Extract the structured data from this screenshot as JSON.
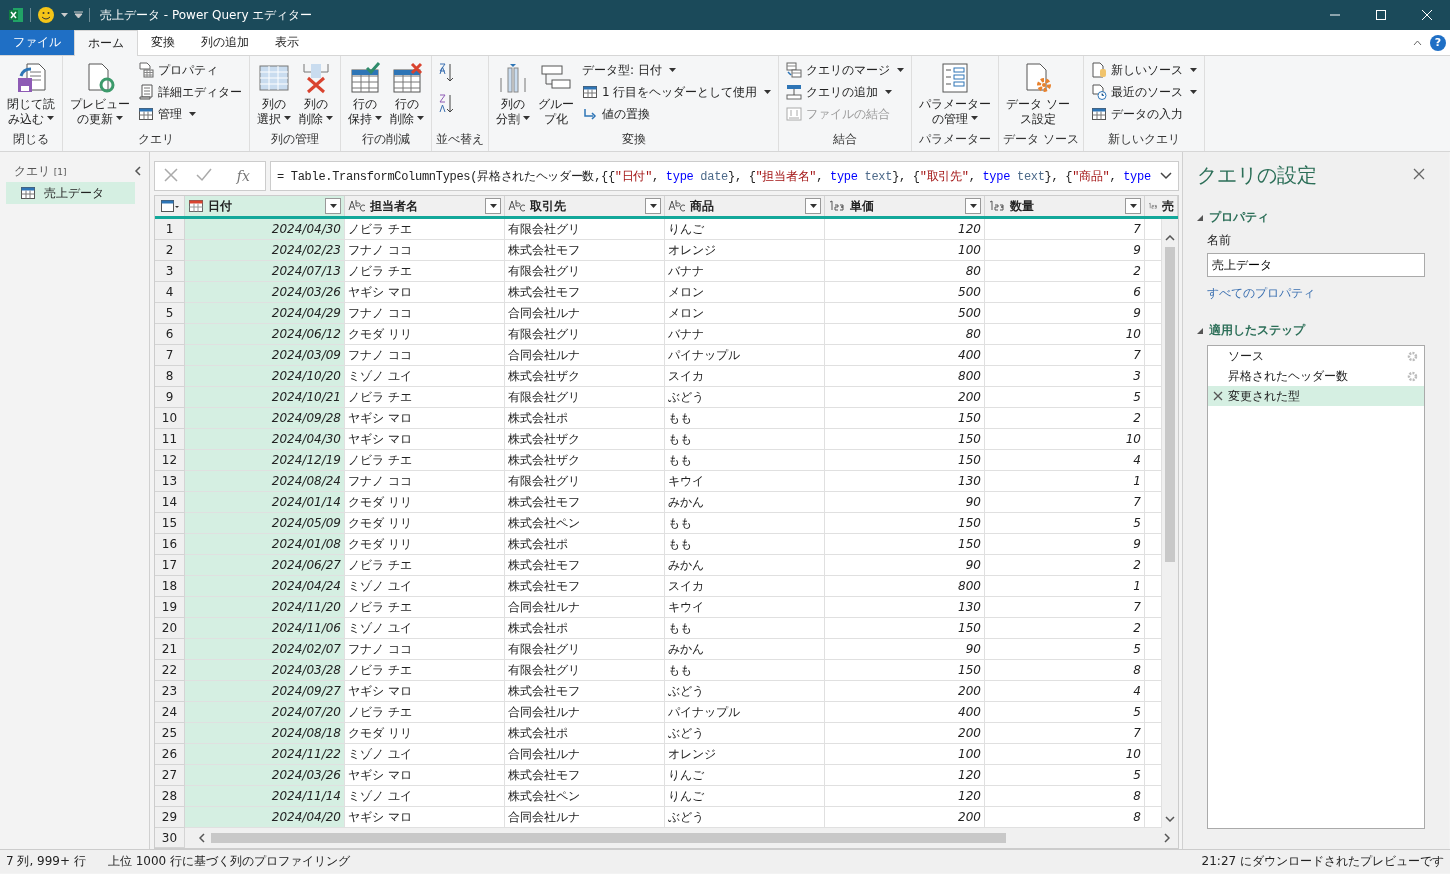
{
  "window": {
    "title": "売上データ - Power Query エディター"
  },
  "tabs": [
    {
      "label": "ファイル",
      "kind": "file",
      "selected": false
    },
    {
      "label": "ホーム",
      "kind": "tab",
      "selected": true
    },
    {
      "label": "変換",
      "kind": "tab",
      "selected": false
    },
    {
      "label": "列の追加",
      "kind": "tab",
      "selected": false
    },
    {
      "label": "表示",
      "kind": "tab",
      "selected": false
    }
  ],
  "help": "?",
  "ribbon": [
    {
      "label": "閉じる",
      "items": [
        {
          "kind": "big",
          "lines": [
            "閉じて読",
            "み込む"
          ],
          "dropdown": true
        }
      ]
    },
    {
      "label": "クエリ",
      "items": [
        {
          "kind": "big",
          "lines": [
            "プレビュー",
            "の更新"
          ],
          "dropdown": true
        },
        {
          "kind": "stack",
          "items": [
            {
              "label": "プロパティ",
              "dropdown": false,
              "disabled": false
            },
            {
              "label": "詳細エディター",
              "dropdown": false,
              "disabled": false
            },
            {
              "label": "管理",
              "dropdown": true,
              "disabled": false
            }
          ]
        }
      ]
    },
    {
      "label": "列の管理",
      "items": [
        {
          "kind": "big",
          "lines": [
            "列の",
            "選択"
          ],
          "dropdown": true
        },
        {
          "kind": "big",
          "lines": [
            "列の",
            "削除"
          ],
          "dropdown": true
        }
      ]
    },
    {
      "label": "行の削減",
      "items": [
        {
          "kind": "big",
          "lines": [
            "行の",
            "保持"
          ],
          "dropdown": true
        },
        {
          "kind": "big",
          "lines": [
            "行の",
            "削除"
          ],
          "dropdown": true
        }
      ]
    },
    {
      "label": "並べ替え",
      "items": [
        {
          "kind": "sort"
        }
      ]
    },
    {
      "label": "変換",
      "items": [
        {
          "kind": "big",
          "lines": [
            "列の",
            "分割"
          ],
          "dropdown": true
        },
        {
          "kind": "big",
          "lines": [
            "グルー",
            "プ化"
          ],
          "dropdown": false
        },
        {
          "kind": "stack",
          "items": [
            {
              "label": "データ型: 日付",
              "dropdown": true,
              "disabled": false
            },
            {
              "label": "1 行目をヘッダーとして使用",
              "dropdown": true,
              "disabled": false
            },
            {
              "label": "値の置換",
              "dropdown": false,
              "disabled": false
            }
          ]
        }
      ]
    },
    {
      "label": "結合",
      "items": [
        {
          "kind": "stack",
          "items": [
            {
              "label": "クエリのマージ",
              "dropdown": true,
              "disabled": false
            },
            {
              "label": "クエリの追加",
              "dropdown": true,
              "disabled": false
            },
            {
              "label": "ファイルの結合",
              "dropdown": false,
              "disabled": true
            }
          ]
        }
      ]
    },
    {
      "label": "パラメーター",
      "items": [
        {
          "kind": "big",
          "lines": [
            "パラメーター",
            "の管理"
          ],
          "dropdown": true
        }
      ]
    },
    {
      "label": "データ ソース",
      "items": [
        {
          "kind": "big",
          "lines": [
            "データ ソー",
            "ス設定"
          ],
          "dropdown": false
        }
      ]
    },
    {
      "label": "新しいクエリ",
      "items": [
        {
          "kind": "stack",
          "items": [
            {
              "label": "新しいソース",
              "dropdown": true,
              "disabled": false
            },
            {
              "label": "最近のソース",
              "dropdown": true,
              "disabled": false
            },
            {
              "label": "データの入力",
              "dropdown": false,
              "disabled": false
            }
          ]
        }
      ]
    }
  ],
  "queries": {
    "title": "クエリ",
    "count": "[1]",
    "items": [
      {
        "label": "売上データ",
        "selected": true
      }
    ]
  },
  "formula_bar": {
    "fx": "fx",
    "tokens": [
      {
        "kind": "plain",
        "text": "= Table.TransformColumnTypes(昇格されたヘッダー数,{{"
      },
      {
        "kind": "string",
        "text": "\"日付\""
      },
      {
        "kind": "plain",
        "text": ", "
      },
      {
        "kind": "keyword",
        "text": "type"
      },
      {
        "kind": "typename",
        "text": " date"
      },
      {
        "kind": "plain",
        "text": "}, {"
      },
      {
        "kind": "string",
        "text": "\"担当者名\""
      },
      {
        "kind": "plain",
        "text": ", "
      },
      {
        "kind": "keyword",
        "text": "type"
      },
      {
        "kind": "typename",
        "text": " text"
      },
      {
        "kind": "plain",
        "text": "}, {"
      },
      {
        "kind": "string",
        "text": "\"取引先\""
      },
      {
        "kind": "plain",
        "text": ", "
      },
      {
        "kind": "keyword",
        "text": "type"
      },
      {
        "kind": "typename",
        "text": " text"
      },
      {
        "kind": "plain",
        "text": "}, {"
      },
      {
        "kind": "string",
        "text": "\"商品\""
      },
      {
        "kind": "plain",
        "text": ", "
      },
      {
        "kind": "keyword",
        "text": "type"
      }
    ]
  },
  "table": {
    "columns": [
      {
        "name": "日付",
        "kind": "date",
        "selected": true
      },
      {
        "name": "担当者名",
        "kind": "text",
        "selected": false
      },
      {
        "name": "取引先",
        "kind": "text",
        "selected": false
      },
      {
        "name": "商品",
        "kind": "text",
        "selected": false
      },
      {
        "name": "単価",
        "kind": "number",
        "selected": false
      },
      {
        "name": "数量",
        "kind": "number",
        "selected": false
      },
      {
        "name": "売",
        "kind": "number",
        "selected": false
      }
    ],
    "rows": [
      {
        "num": "1",
        "cells": [
          "2024/04/30",
          "ノビラ チエ",
          "有限会社グリ",
          "りんご",
          "120",
          "7"
        ]
      },
      {
        "num": "2",
        "cells": [
          "2024/02/23",
          "フナノ ココ",
          "株式会社モフ",
          "オレンジ",
          "100",
          "9"
        ]
      },
      {
        "num": "3",
        "cells": [
          "2024/07/13",
          "ノビラ チエ",
          "有限会社グリ",
          "バナナ",
          "80",
          "2"
        ]
      },
      {
        "num": "4",
        "cells": [
          "2024/03/26",
          "ヤギシ マロ",
          "株式会社モフ",
          "メロン",
          "500",
          "6"
        ]
      },
      {
        "num": "5",
        "cells": [
          "2024/04/29",
          "フナノ ココ",
          "合同会社ルナ",
          "メロン",
          "500",
          "9"
        ]
      },
      {
        "num": "6",
        "cells": [
          "2024/06/12",
          "クモダ リリ",
          "有限会社グリ",
          "バナナ",
          "80",
          "10"
        ]
      },
      {
        "num": "7",
        "cells": [
          "2024/03/09",
          "フナノ ココ",
          "合同会社ルナ",
          "パイナップル",
          "400",
          "7"
        ]
      },
      {
        "num": "8",
        "cells": [
          "2024/10/20",
          "ミゾノ ユイ",
          "株式会社ザク",
          "スイカ",
          "800",
          "3"
        ]
      },
      {
        "num": "9",
        "cells": [
          "2024/10/21",
          "ノビラ チエ",
          "有限会社グリ",
          "ぶどう",
          "200",
          "5"
        ]
      },
      {
        "num": "10",
        "cells": [
          "2024/09/28",
          "ヤギシ マロ",
          "株式会社ポ",
          "もも",
          "150",
          "2"
        ]
      },
      {
        "num": "11",
        "cells": [
          "2024/04/30",
          "ヤギシ マロ",
          "株式会社ザク",
          "もも",
          "150",
          "10"
        ]
      },
      {
        "num": "12",
        "cells": [
          "2024/12/19",
          "ノビラ チエ",
          "株式会社ザク",
          "もも",
          "150",
          "4"
        ]
      },
      {
        "num": "13",
        "cells": [
          "2024/08/24",
          "フナノ ココ",
          "有限会社グリ",
          "キウイ",
          "130",
          "1"
        ]
      },
      {
        "num": "14",
        "cells": [
          "2024/01/14",
          "クモダ リリ",
          "株式会社モフ",
          "みかん",
          "90",
          "7"
        ]
      },
      {
        "num": "15",
        "cells": [
          "2024/05/09",
          "クモダ リリ",
          "株式会社ペン",
          "もも",
          "150",
          "5"
        ]
      },
      {
        "num": "16",
        "cells": [
          "2024/01/08",
          "クモダ リリ",
          "株式会社ポ",
          "もも",
          "150",
          "9"
        ]
      },
      {
        "num": "17",
        "cells": [
          "2024/06/27",
          "ノビラ チエ",
          "株式会社モフ",
          "みかん",
          "90",
          "2"
        ]
      },
      {
        "num": "18",
        "cells": [
          "2024/04/24",
          "ミゾノ ユイ",
          "株式会社モフ",
          "スイカ",
          "800",
          "1"
        ]
      },
      {
        "num": "19",
        "cells": [
          "2024/11/20",
          "ノビラ チエ",
          "合同会社ルナ",
          "キウイ",
          "130",
          "7"
        ]
      },
      {
        "num": "20",
        "cells": [
          "2024/11/06",
          "ミゾノ ユイ",
          "株式会社ポ",
          "もも",
          "150",
          "2"
        ]
      },
      {
        "num": "21",
        "cells": [
          "2024/02/07",
          "フナノ ココ",
          "有限会社グリ",
          "みかん",
          "90",
          "5"
        ]
      },
      {
        "num": "22",
        "cells": [
          "2024/03/28",
          "ノビラ チエ",
          "有限会社グリ",
          "もも",
          "150",
          "8"
        ]
      },
      {
        "num": "23",
        "cells": [
          "2024/09/27",
          "ヤギシ マロ",
          "株式会社モフ",
          "ぶどう",
          "200",
          "4"
        ]
      },
      {
        "num": "24",
        "cells": [
          "2024/07/20",
          "ノビラ チエ",
          "合同会社ルナ",
          "パイナップル",
          "400",
          "5"
        ]
      },
      {
        "num": "25",
        "cells": [
          "2024/08/18",
          "クモダ リリ",
          "株式会社ポ",
          "ぶどう",
          "200",
          "7"
        ]
      },
      {
        "num": "26",
        "cells": [
          "2024/11/22",
          "ミゾノ ユイ",
          "合同会社ルナ",
          "オレンジ",
          "100",
          "10"
        ]
      },
      {
        "num": "27",
        "cells": [
          "2024/03/26",
          "ヤギシ マロ",
          "株式会社モフ",
          "りんご",
          "120",
          "5"
        ]
      },
      {
        "num": "28",
        "cells": [
          "2024/11/14",
          "ミゾノ ユイ",
          "株式会社ペン",
          "りんご",
          "120",
          "8"
        ]
      },
      {
        "num": "29",
        "cells": [
          "2024/04/20",
          "ヤギシ マロ",
          "合同会社ルナ",
          "ぶどう",
          "200",
          "8"
        ]
      }
    ],
    "last_row_number": "30"
  },
  "settings": {
    "title": "クエリの設定",
    "properties_heading": "プロパティ",
    "name_label": "名前",
    "name_value": "売上データ",
    "all_properties_link": "すべてのプロパティ",
    "steps_heading": "適用したステップ",
    "steps": [
      {
        "label": "ソース",
        "selected": false,
        "has_settings": true
      },
      {
        "label": "昇格されたヘッダー数",
        "selected": false,
        "has_settings": true
      },
      {
        "label": "変更された型",
        "selected": true,
        "has_settings": false
      }
    ]
  },
  "status_bar": {
    "columns_rows": "7 列, 999+ 行",
    "profiling": "上位 1000 行に基づく列のプロファイリング",
    "preview_info": "21:27 にダウンロードされたプレビューです"
  }
}
